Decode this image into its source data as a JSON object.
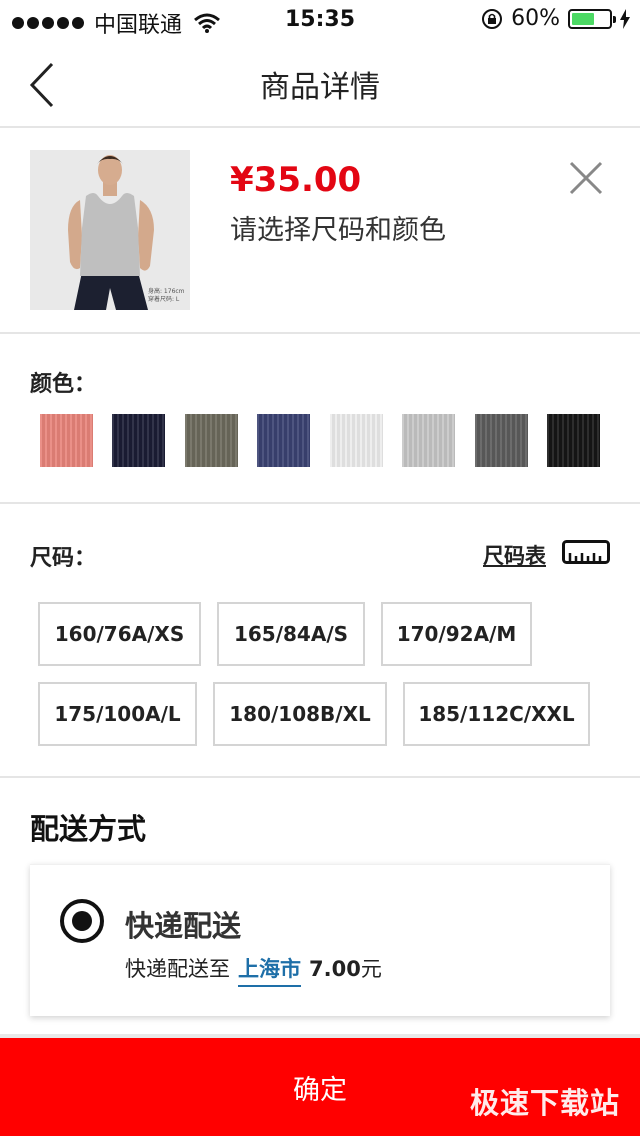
{
  "status_bar": {
    "carrier": "中国联通",
    "time": "15:35",
    "battery": "60%",
    "battery_level": 0.6,
    "icons": [
      "signal-dots-icon",
      "wifi-icon",
      "rotation-lock-icon",
      "battery-icon",
      "charging-bolt-icon"
    ]
  },
  "nav": {
    "title": "商品详情",
    "back_icon": "chevron-left-icon"
  },
  "product": {
    "price": "¥35.00",
    "prompt": "请选择尺码和颜色",
    "image_caption": "身高: 176cm 穿着尺码: L",
    "close_icon": "close-icon"
  },
  "colors": {
    "label": "颜色：",
    "swatches": [
      {
        "color": "#e8847a"
      },
      {
        "color": "#1b1d35"
      },
      {
        "color": "#6c6a5c"
      },
      {
        "color": "#3a4272"
      },
      {
        "color": "#ececec"
      },
      {
        "color": "#c6c6c6"
      },
      {
        "color": "#5c5c5c"
      },
      {
        "color": "#161616"
      }
    ]
  },
  "sizes": {
    "label": "尺码：",
    "chart_link": "尺码表",
    "chart_icon": "ruler-icon",
    "options": [
      "160/76A/XS",
      "165/84A/S",
      "170/92A/M",
      "175/100A/L",
      "180/108B/XL",
      "185/112C/XXL"
    ]
  },
  "delivery": {
    "title": "配送方式",
    "option_name": "快递配送",
    "desc_prefix": "快递配送至",
    "city": "上海市",
    "fee": "7.00",
    "fee_unit": "元",
    "selected": true
  },
  "confirm": {
    "label": "确定"
  },
  "watermark": "极速下载站"
}
